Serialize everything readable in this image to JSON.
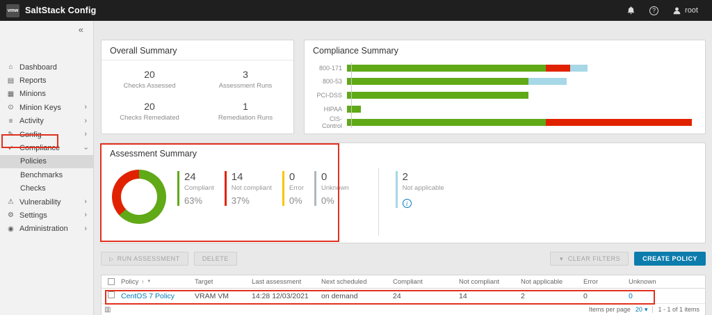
{
  "topbar": {
    "logo": "vmw",
    "title": "SaltStack Config",
    "user": "root"
  },
  "icons": {
    "collapse": "«",
    "play": "▷",
    "filter": "▼",
    "sort_asc": "↑",
    "caret_down": "▾",
    "info": "i",
    "help": "?",
    "column_picker": "▥"
  },
  "sidebar": {
    "items": [
      {
        "label": "Dashboard",
        "icon": "dashboard-icon",
        "glyph": "⌂"
      },
      {
        "label": "Reports",
        "icon": "reports-icon",
        "glyph": "▤"
      },
      {
        "label": "Minions",
        "icon": "minions-icon",
        "glyph": "▦"
      },
      {
        "label": "Minion Keys",
        "icon": "minion-keys-icon",
        "glyph": "⊙",
        "expandable": true
      },
      {
        "label": "Activity",
        "icon": "activity-icon",
        "glyph": "≡",
        "expandable": true
      },
      {
        "label": "Config",
        "icon": "config-icon",
        "glyph": "✎",
        "expandable": true
      },
      {
        "label": "Compliance",
        "icon": "compliance-icon",
        "glyph": "✓",
        "expandable": true,
        "expanded": true
      },
      {
        "label": "Policies",
        "child": true,
        "selected": true
      },
      {
        "label": "Benchmarks",
        "child": true
      },
      {
        "label": "Checks",
        "child": true
      },
      {
        "label": "Vulnerability",
        "icon": "vulnerability-icon",
        "glyph": "⚠",
        "expandable": true
      },
      {
        "label": "Settings",
        "icon": "settings-icon",
        "glyph": "⚙",
        "expandable": true
      },
      {
        "label": "Administration",
        "icon": "administration-icon",
        "glyph": "◉",
        "expandable": true
      }
    ]
  },
  "overall_summary": {
    "title": "Overall Summary",
    "stats": [
      {
        "value": "20",
        "label": "Checks Assessed"
      },
      {
        "value": "3",
        "label": "Assessment Runs"
      },
      {
        "value": "20",
        "label": "Checks Remediated"
      },
      {
        "value": "1",
        "label": "Remediation Runs"
      }
    ]
  },
  "compliance_summary": {
    "title": "Compliance Summary",
    "chart_data": {
      "type": "bar",
      "orientation": "horizontal",
      "categories": [
        "800-171",
        "800-53",
        "PCI-DSS",
        "HIPAA",
        "CIS-Control"
      ],
      "series": [
        {
          "name": "Compliant",
          "color": "#60a917",
          "values": [
            57,
            52,
            52,
            4,
            57
          ]
        },
        {
          "name": "Not compliant",
          "color": "#e12200",
          "values": [
            7,
            0,
            0,
            0,
            42
          ]
        },
        {
          "name": "Not applicable",
          "color": "#a6d8e7",
          "values": [
            5,
            11,
            0,
            0,
            0
          ]
        }
      ],
      "xlim": [
        0,
        100
      ],
      "legend": "none"
    }
  },
  "assessment_summary": {
    "title": "Assessment Summary",
    "chart_data": {
      "type": "pie",
      "labels": [
        "Compliant",
        "Not compliant",
        "Error",
        "Unknown"
      ],
      "values": [
        63,
        37,
        0,
        0
      ],
      "colors": [
        "#60a917",
        "#e12200",
        "#fac400",
        "#9aa5ab"
      ]
    },
    "stats": [
      {
        "value": "24",
        "label": "Compliant",
        "percent": "63%",
        "color": "#60a917"
      },
      {
        "value": "14",
        "label": "Not compliant",
        "percent": "37%",
        "color": "#e12200"
      },
      {
        "value": "0",
        "label": "Error",
        "percent": "0%",
        "color": "#fac400"
      },
      {
        "value": "0",
        "label": "Unknown",
        "percent": "0%",
        "color": "#aeb8bd"
      }
    ],
    "not_applicable": {
      "value": "2",
      "label": "Not applicable",
      "color": "#a6d8e7"
    }
  },
  "toolbar": {
    "run_assessment": "RUN ASSESSMENT",
    "delete": "DELETE",
    "clear_filters": "CLEAR FILTERS",
    "create_policy": "CREATE POLICY"
  },
  "table": {
    "columns": [
      "Policy",
      "Target",
      "Last assessment",
      "Next scheduled",
      "Compliant",
      "Not compliant",
      "Not applicable",
      "Error",
      "Unknown"
    ],
    "rows": [
      {
        "policy": "CentOS 7 Policy",
        "target": "VRAM VM",
        "last_assessment": "14:28 12/03/2021",
        "next_scheduled": "on demand",
        "compliant": "24",
        "not_compliant": "14",
        "not_applicable": "2",
        "error": "0",
        "unknown": "0"
      }
    ],
    "footer": {
      "items_per_page_label": "Items per page",
      "items_per_page_value": "20",
      "range_label": "1 - 1 of 1 items"
    }
  }
}
